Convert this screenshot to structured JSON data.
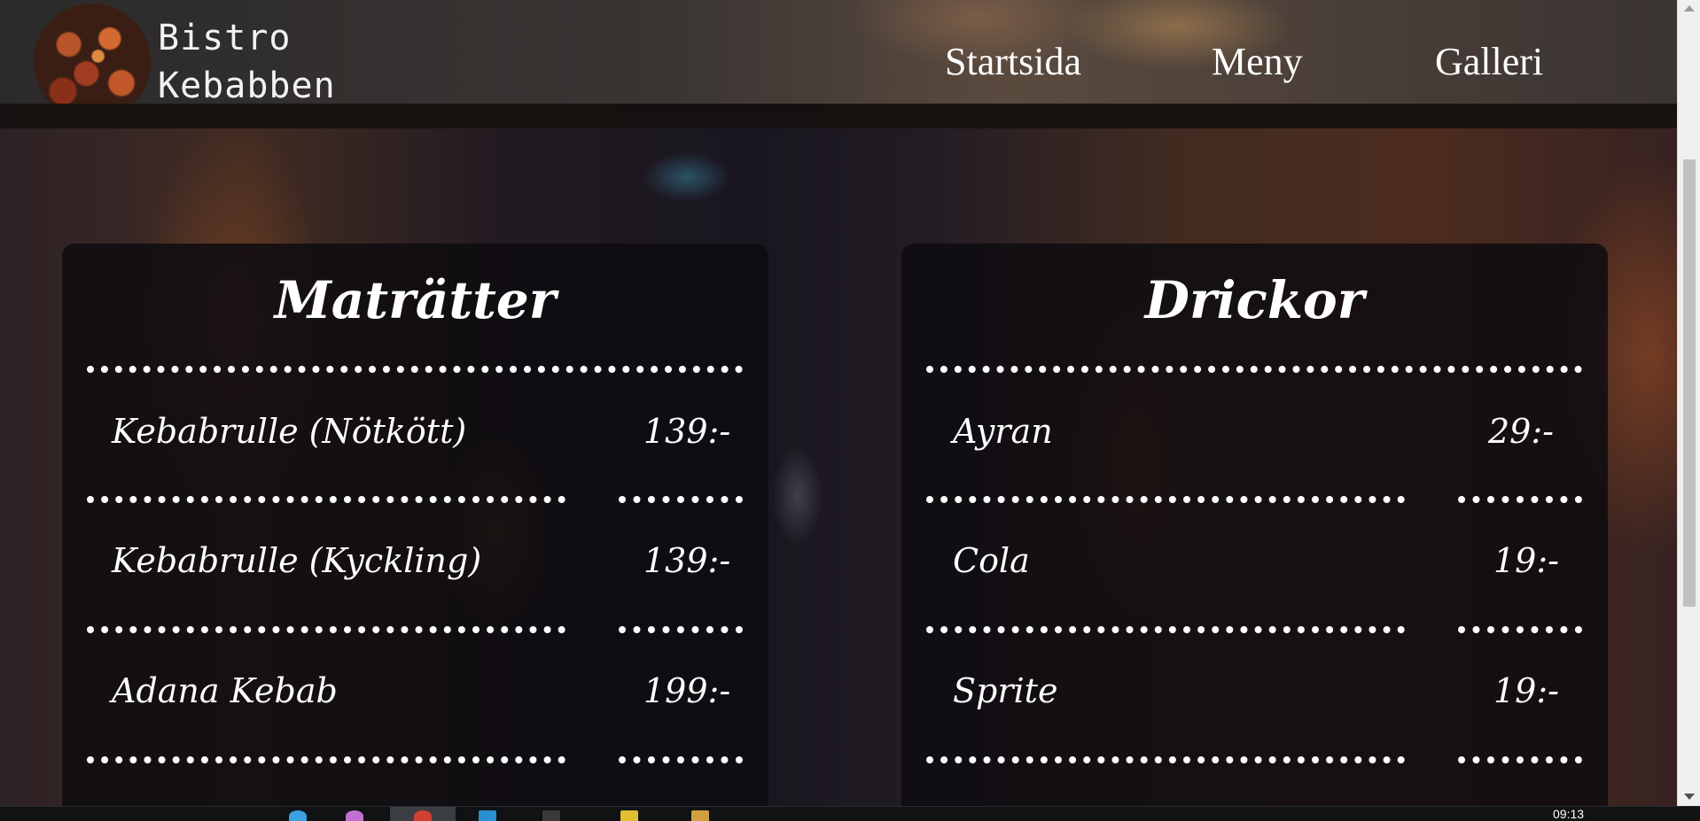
{
  "header": {
    "brand_line1": "Bistro",
    "brand_line2": "Kebabben",
    "nav": [
      "Startsida",
      "Meny",
      "Galleri"
    ]
  },
  "menu": {
    "food": {
      "title": "Maträtter",
      "items": [
        {
          "name": "Kebabrulle (Nötkött)",
          "price": "139:-"
        },
        {
          "name": "Kebabrulle (Kyckling)",
          "price": "139:-"
        },
        {
          "name": "Adana Kebab",
          "price": "199:-"
        }
      ]
    },
    "drinks": {
      "title": "Drickor",
      "items": [
        {
          "name": "Ayran",
          "price": "29:-"
        },
        {
          "name": "Cola",
          "price": "19:-"
        },
        {
          "name": "Sprite",
          "price": "19:-"
        }
      ]
    }
  },
  "taskbar": {
    "clock": "09:13"
  },
  "colors": {
    "panel_bg": "#0e0c10",
    "text": "#ffffff",
    "header_band": "#15110f"
  }
}
